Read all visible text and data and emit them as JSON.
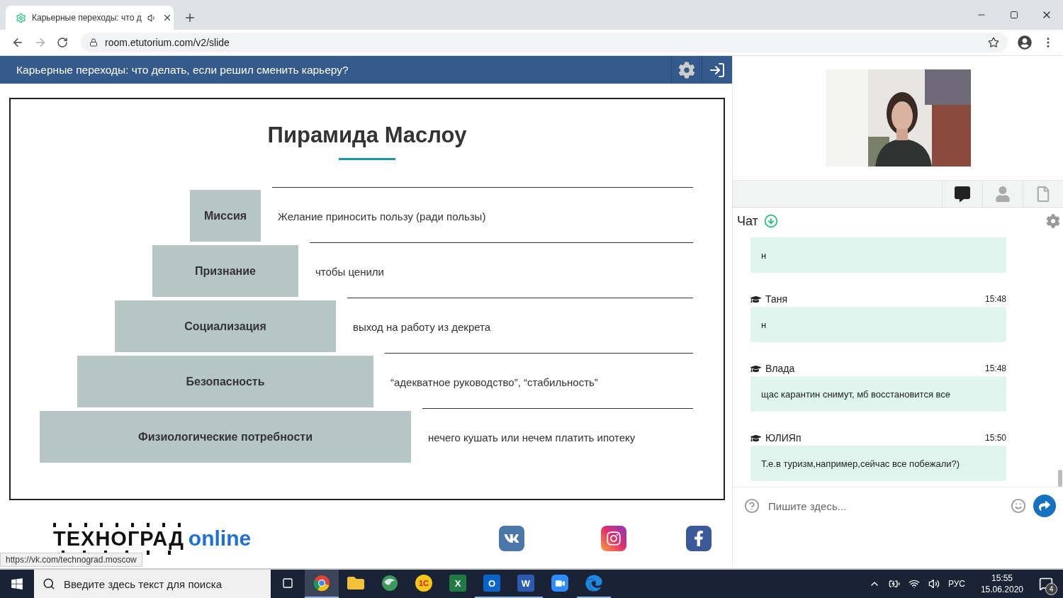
{
  "browser": {
    "tab": {
      "title": "Карьерные переходы: что д",
      "selected": true,
      "audio": true
    },
    "url": "room.etutorium.com/v2/slide"
  },
  "header": {
    "title": "Карьерные переходы: что делать, если решил сменить карьеру?"
  },
  "slide": {
    "title": "Пирамида Маслоу",
    "levels": [
      {
        "name": "Миссия",
        "note": "Желание приносить пользу (ради пользы)"
      },
      {
        "name": "Признание",
        "note": "чтобы ценили"
      },
      {
        "name": "Социализация",
        "note": "выход на работу из декрета"
      },
      {
        "name": "Безопасность",
        "note": "“адекватное руководство”, “стабильность”"
      },
      {
        "name": "Физиологические потребности",
        "note": "нечего кушать или нечем платить ипотеку"
      }
    ]
  },
  "footer": {
    "logo_main": "ТЕХНОГРАД",
    "logo_suffix": "online",
    "socials": [
      {
        "kind": "vk"
      },
      {
        "kind": "instagram"
      },
      {
        "kind": "facebook"
      }
    ]
  },
  "status_url": "https://vk.com/technograd.moscow",
  "chat": {
    "title": "Чат",
    "tabs": [
      {
        "kind": "chat",
        "selected": true
      },
      {
        "kind": "user",
        "selected": false
      },
      {
        "kind": "file",
        "selected": false
      }
    ],
    "messages": [
      {
        "text": "н"
      },
      {
        "author": "Таня",
        "time": "15:48",
        "text": "н"
      },
      {
        "author": "Влада",
        "time": "15:48",
        "text": "щас карантин снимут, мб восстановится все"
      },
      {
        "author": "ЮЛИЯп",
        "time": "15:50",
        "text": "Т.е.в туризм,например,сейчас все побежали?)"
      }
    ],
    "input": {
      "placeholder": "Пишите здесь..."
    }
  },
  "taskbar": {
    "search_placeholder": "Введите здесь текст для поиска",
    "apps": [
      {
        "kind": "taskview",
        "selected": false,
        "running": false
      },
      {
        "kind": "chrome",
        "selected": true,
        "running": true
      },
      {
        "kind": "explorer",
        "selected": false,
        "running": false
      },
      {
        "kind": "globe",
        "selected": false,
        "running": false
      },
      {
        "kind": "onec",
        "glyph": "1С",
        "selected": false,
        "running": false
      },
      {
        "kind": "excel",
        "glyph": "X",
        "selected": false,
        "running": false
      },
      {
        "kind": "outlook",
        "glyph": "O",
        "selected": false,
        "running": true
      },
      {
        "kind": "word",
        "glyph": "W",
        "selected": false,
        "running": true
      },
      {
        "kind": "zoom",
        "selected": false,
        "running": false
      },
      {
        "kind": "edge",
        "selected": false,
        "running": true
      }
    ],
    "tray": {
      "language": "РУС",
      "time": "15:55",
      "date": "15.06.2020",
      "notifications": "4"
    }
  }
}
